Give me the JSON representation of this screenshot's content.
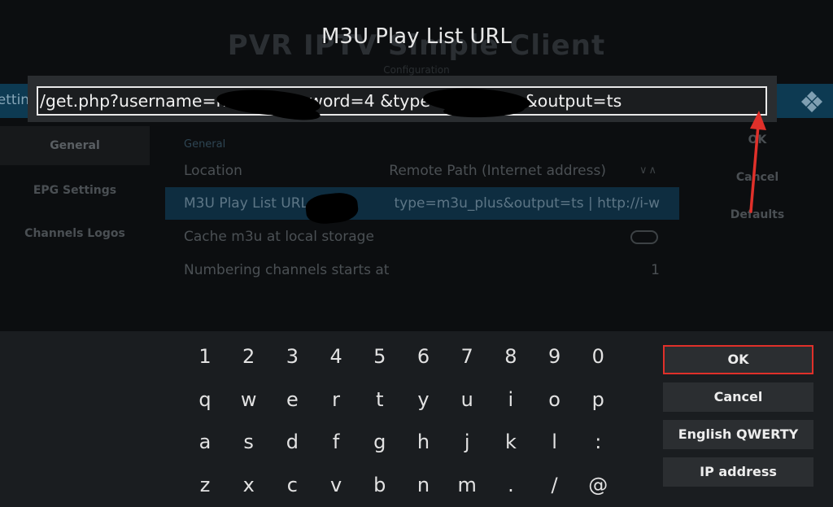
{
  "background": {
    "title": "PVR IPTV Simple Client",
    "subtitle": "Configuration",
    "settings_tab": "Settings",
    "sidebar": [
      "General",
      "EPG Settings",
      "Channels Logos"
    ],
    "section_heading": "General",
    "rows": [
      {
        "label": "Location",
        "value": "Remote Path (Internet address)"
      },
      {
        "label": "M3U Play List URL",
        "value": "type=m3u_plus&output=ts | http://i-w"
      },
      {
        "label": "Cache m3u at local storage",
        "value": ""
      },
      {
        "label": "Numbering channels starts at",
        "value": "1"
      }
    ],
    "right_buttons": [
      "OK",
      "Cancel",
      "Defaults"
    ]
  },
  "dialog": {
    "title": "M3U Play List URL",
    "url_value": "/get.php?username=nM          C&password=4                    &type=m3u_plus&output=ts"
  },
  "keyboard": {
    "rows": [
      [
        "1",
        "2",
        "3",
        "4",
        "5",
        "6",
        "7",
        "8",
        "9",
        "0"
      ],
      [
        "q",
        "w",
        "e",
        "r",
        "t",
        "y",
        "u",
        "i",
        "o",
        "p"
      ],
      [
        "a",
        "s",
        "d",
        "f",
        "g",
        "h",
        "j",
        "k",
        "l",
        ":"
      ],
      [
        "z",
        "x",
        "c",
        "v",
        "b",
        "n",
        "m",
        ".",
        "/",
        "@"
      ]
    ],
    "buttons": {
      "ok": "OK",
      "cancel": "Cancel",
      "layout": "English QWERTY",
      "ip": "IP address"
    }
  },
  "colors": {
    "annotation": "#e0302a",
    "header_strip": "#0d3a52",
    "focused_row": "#0e2d40"
  }
}
